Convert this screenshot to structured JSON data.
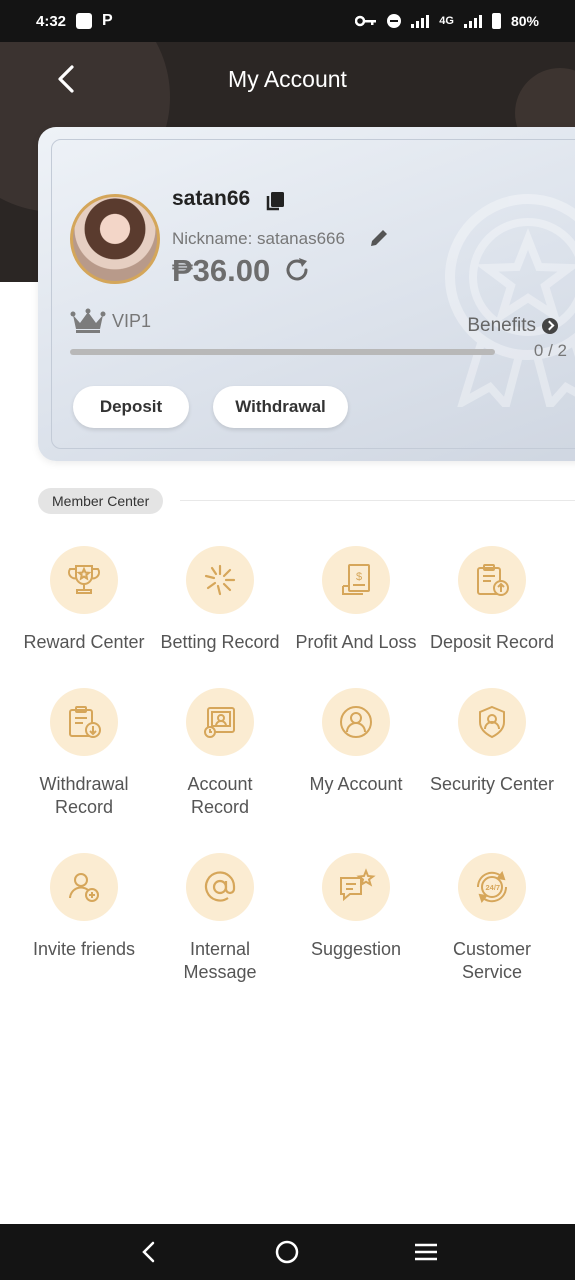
{
  "status_bar": {
    "time": "4:32",
    "network": "4G",
    "battery": "80%"
  },
  "header": {
    "title": "My Account",
    "back_icon": "chevron-left-icon"
  },
  "account": {
    "username": "satan66",
    "nickname": "Nickname: satanas666",
    "balance": "₱36.00",
    "vip_level": "VIP1",
    "benefits_label": "Benefits",
    "progress_text": "0 / 2",
    "progress_fraction": 0,
    "deposit_label": "Deposit",
    "withdrawal_label": "Withdrawal"
  },
  "member_center": {
    "title": "Member Center",
    "items": [
      {
        "label": "Reward Center",
        "icon": "trophy-icon"
      },
      {
        "label": "Betting Record",
        "icon": "sparkle-icon"
      },
      {
        "label": "Profit And Loss",
        "icon": "receipt-icon"
      },
      {
        "label": "Deposit Record",
        "icon": "clipboard-upload-icon"
      },
      {
        "label": "Withdrawal\nRecord",
        "icon": "clipboard-download-icon"
      },
      {
        "label": "Account\nRecord",
        "icon": "account-record-icon"
      },
      {
        "label": "My Account",
        "icon": "user-circle-icon"
      },
      {
        "label": "Security Center",
        "icon": "shield-user-icon"
      },
      {
        "label": "Invite friends",
        "icon": "user-add-icon"
      },
      {
        "label": "Internal\nMessage",
        "icon": "at-sign-icon"
      },
      {
        "label": "Suggestion",
        "icon": "chat-star-icon"
      },
      {
        "label": "Customer\nService",
        "icon": "support-24-7-icon"
      }
    ]
  },
  "colors": {
    "accent": "#c9a24a",
    "icon_bg": "#fbecd2",
    "icon_stroke": "#d6a65a",
    "header_bg": "#2b2624"
  }
}
